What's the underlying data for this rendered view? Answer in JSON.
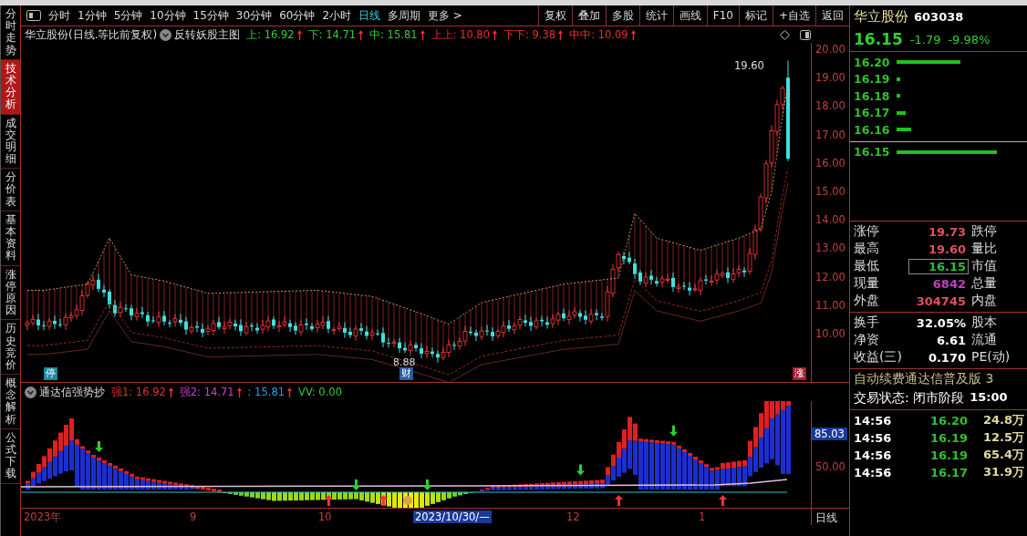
{
  "sidebar": {
    "tabs": [
      {
        "label": "分时走势",
        "selected": false
      },
      {
        "label": "技术分析",
        "selected": true
      },
      {
        "label": "成交明细",
        "selected": false
      },
      {
        "label": "分价表",
        "selected": false
      },
      {
        "label": "基本资料",
        "selected": false
      },
      {
        "label": "涨停原因",
        "selected": false
      },
      {
        "label": "历史竞价",
        "selected": false
      },
      {
        "label": "概念解析",
        "selected": false
      },
      {
        "label": "公式下载",
        "selected": false
      }
    ]
  },
  "toolbar": {
    "periods": [
      {
        "label": "分时",
        "selected": false
      },
      {
        "label": "1分钟",
        "selected": false
      },
      {
        "label": "5分钟",
        "selected": false
      },
      {
        "label": "10分钟",
        "selected": false
      },
      {
        "label": "15分钟",
        "selected": false
      },
      {
        "label": "30分钟",
        "selected": false
      },
      {
        "label": "60分钟",
        "selected": false
      },
      {
        "label": "2小时",
        "selected": false
      },
      {
        "label": "日线",
        "selected": true
      },
      {
        "label": "多周期",
        "selected": false
      },
      {
        "label": "更多 >",
        "selected": false
      }
    ],
    "buttons": [
      "复权",
      "叠加",
      "多股",
      "统计",
      "画线",
      "F10",
      "标记",
      "+自选",
      "返回"
    ]
  },
  "main_chart": {
    "title": "华立股份(日线.等比前复权)",
    "indicator": "反转妖股主图",
    "legend": [
      {
        "text": "上: 16.92",
        "color": "#33cc33"
      },
      {
        "text": "下: 14.71",
        "color": "#33cc33"
      },
      {
        "text": "中: 15.81",
        "color": "#33cc33"
      },
      {
        "text": "上上: 10.80",
        "color": "#e83030"
      },
      {
        "text": "下下: 9.38",
        "color": "#e83030"
      },
      {
        "text": "中中: 10.09",
        "color": "#e83030"
      }
    ],
    "y_axis": [
      "20.00",
      "19.00",
      "18.00",
      "17.00",
      "16.00",
      "15.00",
      "14.00",
      "13.00",
      "12.00",
      "11.00",
      "10.00"
    ],
    "high_label": "19.60",
    "low_label": "8.88",
    "markers": [
      {
        "text": "停",
        "color": "#1a8a9a"
      },
      {
        "text": "财",
        "color": "#2a5aa0"
      },
      {
        "text": "涨",
        "color": "#a02030"
      }
    ]
  },
  "sub_chart": {
    "indicator": "通达信强势抄",
    "legend": [
      {
        "text": "强1: 16.92",
        "color": "#e83030"
      },
      {
        "text": "强2: 14.71",
        "color": "#d040d0"
      },
      {
        "text": ": 15.81",
        "color": "#30a0e0"
      },
      {
        "text": "VV: 0.00",
        "color": "#33cc33"
      }
    ],
    "y_axis": [
      {
        "text": "85.03",
        "selected": true
      },
      {
        "text": "50.00",
        "selected": false
      }
    ]
  },
  "date_axis": [
    {
      "text": "2023年",
      "selected": false
    },
    {
      "text": "9",
      "selected": false
    },
    {
      "text": "10",
      "selected": false
    },
    {
      "text": "2023/10/30/—",
      "selected": true
    },
    {
      "text": "12",
      "selected": false
    },
    {
      "text": "1",
      "selected": false
    }
  ],
  "period_label": "日线",
  "quote": {
    "name": "华立股份",
    "code": "603038",
    "price": "16.15",
    "change": "-1.79",
    "change_pct": "-9.98%",
    "order_book": [
      {
        "price": "16.20"
      },
      {
        "price": "16.19"
      },
      {
        "price": "16.18"
      },
      {
        "price": "16.17"
      },
      {
        "price": "16.16"
      }
    ],
    "bid": {
      "price": "16.15"
    },
    "stats": [
      {
        "label": "涨停",
        "value": "19.73",
        "color": "#e05060",
        "boxed": false,
        "label2": "跌停"
      },
      {
        "label": "最高",
        "value": "19.60",
        "color": "#e05060",
        "boxed": false,
        "label2": "量比"
      },
      {
        "label": "最低",
        "value": "16.15",
        "color": "#33bb33",
        "boxed": true,
        "label2": "市值"
      },
      {
        "label": "现量",
        "value": "6842",
        "color": "#c040c0",
        "boxed": false,
        "label2": "总量"
      },
      {
        "label": "外盘",
        "value": "304745",
        "color": "#e05060",
        "boxed": false,
        "label2": "内盘"
      }
    ],
    "stats2": [
      {
        "label": "换手",
        "value": "32.05%",
        "label2": "股本"
      },
      {
        "label": "净资",
        "value": "6.61",
        "label2": "流通"
      },
      {
        "label": "收益(三)",
        "value": "0.170",
        "label2": "PE(动)"
      }
    ],
    "ad": "自动续费通达信普及版 3",
    "status_label": "交易状态: 闭市阶段",
    "status_time": "15:00",
    "trades": [
      {
        "time": "14:56",
        "price": "16.20",
        "volume": "24.8万"
      },
      {
        "time": "14:56",
        "price": "16.19",
        "volume": "12.5万"
      },
      {
        "time": "14:56",
        "price": "16.19",
        "volume": "65.4万"
      },
      {
        "time": "14:56",
        "price": "16.17",
        "volume": "31.9万"
      }
    ]
  }
}
